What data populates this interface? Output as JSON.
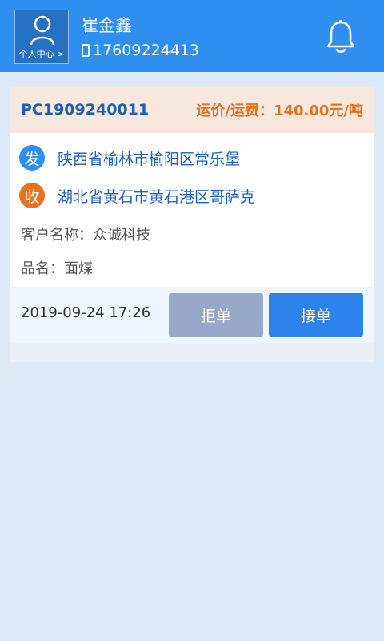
{
  "header": {
    "avatar_caption": "个人中心 >",
    "user_name": "崔金鑫",
    "phone": "17609224413"
  },
  "order": {
    "number": "PC1909240011",
    "freight_label": "运价/运费：140.00元/吨",
    "from_badge": "发",
    "from_address": "陕西省榆林市榆阳区常乐堡",
    "to_badge": "收",
    "to_address": "湖北省黄石市黄石港区哥萨克",
    "customer": "客户名称：众诚科技",
    "product": "品名：面煤",
    "time": "2019-09-24 17:26",
    "reject_label": "拒单",
    "accept_label": "接单"
  },
  "colors": {
    "header_bg": "#2f8ff0",
    "from_badge": "#2f8ff0",
    "to_badge": "#e8731f",
    "freight": "#e0721c",
    "order_no": "#1c5fb5"
  }
}
